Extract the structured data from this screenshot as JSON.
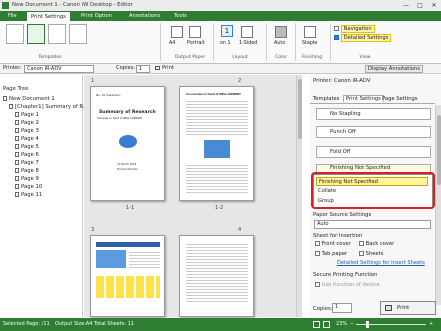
{
  "window": {
    "title": "New Document 1 - Canon iW Desktop - Editor",
    "min": "—",
    "max": "□",
    "close": "✕"
  },
  "menu_tabs": [
    "File",
    "Print Settings",
    "Print Option",
    "Annotations",
    "Tools"
  ],
  "ribbon": {
    "groups": {
      "templates": "Templates",
      "output_paper": "Output Paper",
      "layout": "Layout",
      "color": "Color",
      "finishing": "Finishing",
      "view": "View"
    },
    "paper_size": "A4",
    "orientation": "Portrait",
    "pages_per_sheet": "1",
    "pages_on": "on 1",
    "print_side": "1-Sided",
    "color_mode": "Auto",
    "staple": "Staple",
    "navigation": "Navigation",
    "detailed_settings": "Detailed Settings"
  },
  "toolbar": {
    "printer_label": "Printer:",
    "printer_value": "Canon iR-ADV",
    "copies_label": "Copies:",
    "copies_value": "1",
    "print_label": "Print",
    "display_annotations": "Display Annotations"
  },
  "page_tree": {
    "title": "Page Tree",
    "root": "New Document 1",
    "chapter": "[Chapter1] Summary of R...",
    "pages": [
      "Page 1",
      "Page 2",
      "Page 3",
      "Page 4",
      "Page 5",
      "Page 6",
      "Page 7",
      "Page 8",
      "Page 9",
      "Page 10",
      "Page 11"
    ]
  },
  "thumbnails": {
    "p1_number": "1",
    "p2_number": "2",
    "p3_number": "3",
    "p4_number": "4",
    "p1_caption": "1-1",
    "p2_caption": "1-2",
    "p1_header": "No. 19 Inspection",
    "p1_title": "Summary of Research",
    "p1_subtitle": "Overview on trend of WELL-COMPANY",
    "p1_footer1": "21 March 2014",
    "p1_footer2": "Product Division",
    "p2_header": "An overview on trend of WELL-COMPANY"
  },
  "properties": {
    "printer": "Printer: Canon iR-ADV",
    "tabs": [
      "Templates",
      "Print Settings",
      "Page Settings"
    ],
    "no_stapling": "No Stapling",
    "punch_off": "Punch Off",
    "fold_off": "Fold Off",
    "finishing_selected": "Finishing Not Specified",
    "dropdown_options": [
      "Finishing Not Specified",
      "Collate",
      "Group"
    ],
    "paper_source_label": "Paper Source Settings",
    "paper_source_value": "Auto",
    "sheet_insertion_label": "Sheet for Insertion",
    "front_cover": "Front cover",
    "back_cover": "Back cover",
    "tab_paper": "Tab paper",
    "sheets": "Sheets",
    "detailed_insert": "Detailed Settings for Insert Sheets",
    "secure_label": "Secure Printing Function",
    "use_function": "Use function of device",
    "copies_label": "Copies:",
    "copies_value": "1",
    "print_button": "Print"
  },
  "status": {
    "selected_page": "Selected Page: /11",
    "output_size": "Output Size:A4",
    "total_sheets": "Total Sheets: 11",
    "zoom": "23%"
  },
  "colors": {
    "accent": "#2e7d32",
    "highlight": "#fff59d",
    "callout": "#e02020"
  }
}
